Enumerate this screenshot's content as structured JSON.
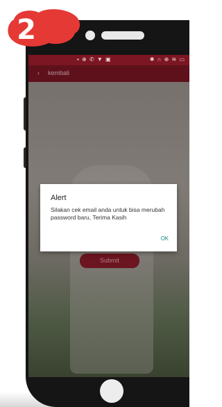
{
  "badge": {
    "step_number": "2",
    "color": "#e53935"
  },
  "status_bar": {
    "left_icons": "▪ ⊕ ✆ ▼ ▣",
    "right_icons": "✱ ∩ ⊕ ≋ ▭"
  },
  "app_bar": {
    "back_icon": "arrow-left-icon",
    "back_label": "kembali"
  },
  "form": {
    "submit_label": "Submit"
  },
  "dialog": {
    "title": "Alert",
    "message": "Silakan cek email anda untuk bisa merubah password baru, Terima Kasih",
    "ok_label": "OK"
  },
  "colors": {
    "status_bar": "#7c1622",
    "app_bar": "#5e111b",
    "accent_ok": "#198a86",
    "phone_frame": "#151515"
  }
}
